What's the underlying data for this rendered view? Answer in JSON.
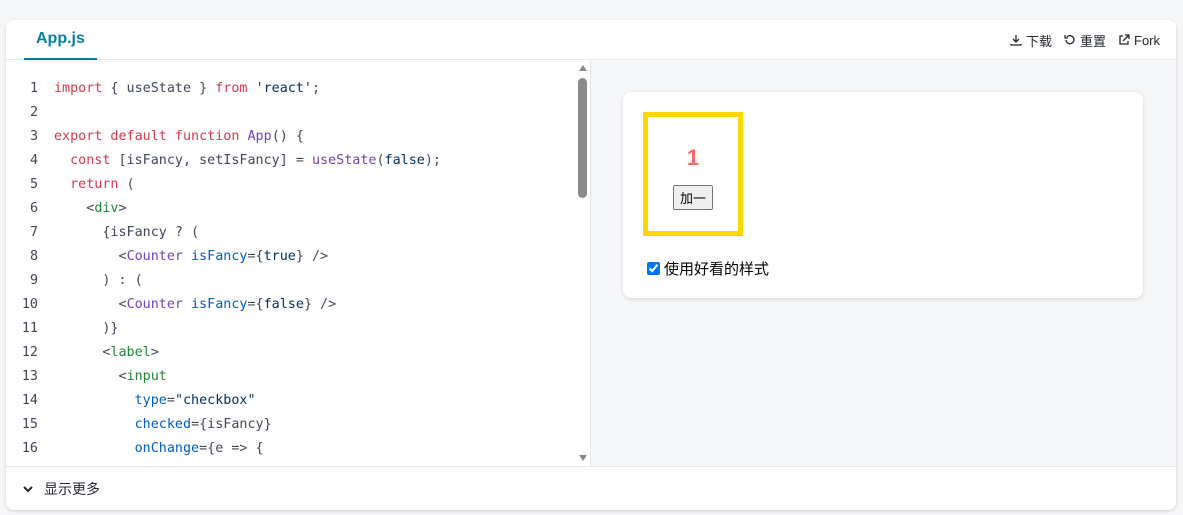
{
  "tab": {
    "label": "App.js"
  },
  "actions": {
    "download": "下载",
    "reset": "重置",
    "fork": "Fork"
  },
  "code": {
    "lines": [
      {
        "n": "1",
        "tokens": [
          [
            "kw",
            "import"
          ],
          [
            "plain",
            " { useState } "
          ],
          [
            "kw",
            "from"
          ],
          [
            "plain",
            " "
          ],
          [
            "str",
            "'react'"
          ],
          [
            "plain",
            ";"
          ]
        ]
      },
      {
        "n": "2",
        "tokens": []
      },
      {
        "n": "3",
        "tokens": [
          [
            "kw",
            "export default function"
          ],
          [
            "plain",
            " "
          ],
          [
            "fn",
            "App"
          ],
          [
            "plain",
            "() {"
          ]
        ]
      },
      {
        "n": "4",
        "tokens": [
          [
            "plain",
            "  "
          ],
          [
            "kw",
            "const"
          ],
          [
            "plain",
            " [isFancy, setIsFancy] = "
          ],
          [
            "fn",
            "useState"
          ],
          [
            "plain",
            "("
          ],
          [
            "str",
            "false"
          ],
          [
            "plain",
            ");"
          ]
        ]
      },
      {
        "n": "5",
        "tokens": [
          [
            "plain",
            "  "
          ],
          [
            "kw",
            "return"
          ],
          [
            "plain",
            " ("
          ]
        ]
      },
      {
        "n": "6",
        "tokens": [
          [
            "plain",
            "    <"
          ],
          [
            "tag",
            "div"
          ],
          [
            "plain",
            ">"
          ]
        ]
      },
      {
        "n": "7",
        "tokens": [
          [
            "plain",
            "      {isFancy ? ("
          ]
        ]
      },
      {
        "n": "8",
        "tokens": [
          [
            "plain",
            "        <"
          ],
          [
            "comp",
            "Counter"
          ],
          [
            "plain",
            " "
          ],
          [
            "attr",
            "isFancy"
          ],
          [
            "plain",
            "={"
          ],
          [
            "str",
            "true"
          ],
          [
            "plain",
            "} />"
          ]
        ]
      },
      {
        "n": "9",
        "tokens": [
          [
            "plain",
            "      ) : ("
          ]
        ]
      },
      {
        "n": "10",
        "tokens": [
          [
            "plain",
            "        <"
          ],
          [
            "comp",
            "Counter"
          ],
          [
            "plain",
            " "
          ],
          [
            "attr",
            "isFancy"
          ],
          [
            "plain",
            "={"
          ],
          [
            "str",
            "false"
          ],
          [
            "plain",
            "} />"
          ]
        ]
      },
      {
        "n": "11",
        "tokens": [
          [
            "plain",
            "      )}"
          ]
        ]
      },
      {
        "n": "12",
        "tokens": [
          [
            "plain",
            "      <"
          ],
          [
            "tag",
            "label"
          ],
          [
            "plain",
            ">"
          ]
        ]
      },
      {
        "n": "13",
        "tokens": [
          [
            "plain",
            "        <"
          ],
          [
            "tag",
            "input"
          ]
        ]
      },
      {
        "n": "14",
        "tokens": [
          [
            "plain",
            "          "
          ],
          [
            "attr",
            "type"
          ],
          [
            "plain",
            "="
          ],
          [
            "str",
            "\"checkbox\""
          ]
        ]
      },
      {
        "n": "15",
        "tokens": [
          [
            "plain",
            "          "
          ],
          [
            "attr",
            "checked"
          ],
          [
            "plain",
            "={isFancy}"
          ]
        ]
      },
      {
        "n": "16",
        "tokens": [
          [
            "plain",
            "          "
          ],
          [
            "attr",
            "onChange"
          ],
          [
            "plain",
            "={e => {"
          ]
        ]
      }
    ]
  },
  "preview": {
    "count": "1",
    "add_label": "加一",
    "checkbox_label": "使用好看的样式",
    "checkbox_checked": true,
    "counter_border_color": "#ffd700",
    "count_color": "#ff6767"
  },
  "footer": {
    "show_more": "显示更多"
  },
  "colors": {
    "accent": "#087ea4"
  }
}
